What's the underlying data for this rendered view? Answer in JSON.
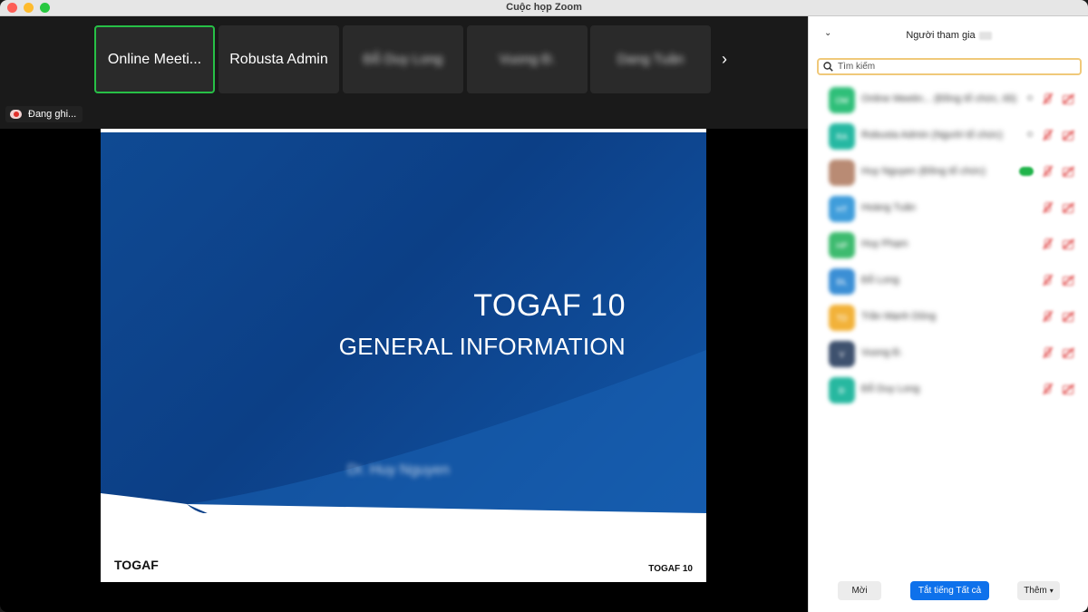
{
  "window": {
    "title": "Cuộc họp Zoom"
  },
  "video_strip": {
    "tiles": [
      {
        "label": "Online Meeti...",
        "active": true
      },
      {
        "label": "Robusta Admin",
        "active": false
      },
      {
        "label": "Đỗ Duy Long",
        "active": false
      },
      {
        "label": "Vuong Đ.",
        "active": false
      },
      {
        "label": "Dang Tuân",
        "active": false
      }
    ],
    "next_icon": "chevron-right-icon",
    "recording_label": "Đang ghi..."
  },
  "slide": {
    "title": "TOGAF 10",
    "subtitle": "GENERAL INFORMATION",
    "author": "Dr. Huy Nguyen",
    "footer_left": "TOGAF",
    "footer_right": "TOGAF 10"
  },
  "participants_panel": {
    "title": "Người tham gia",
    "count": "10",
    "search_placeholder": "Tìm kiếm",
    "participants": [
      {
        "initials": "OM",
        "name": "Online Meetin... (Đồng tổ chức, tôi)",
        "color": "#2fbf79"
      },
      {
        "initials": "RA",
        "name": "Robusta Admin (Người tổ chức)",
        "color": "#25b8a2"
      },
      {
        "initials": "",
        "name": "Huy Nguyen (Đồng tổ chức)",
        "color": "#b98b74"
      },
      {
        "initials": "HT",
        "name": "Hoàng Tuân",
        "color": "#3f9ddb"
      },
      {
        "initials": "HP",
        "name": "Huy Phạm",
        "color": "#3dbb6f"
      },
      {
        "initials": "ĐL",
        "name": "Đỗ Long",
        "color": "#3b8fd5"
      },
      {
        "initials": "TD",
        "name": "Trần Mạnh Dũng",
        "color": "#f2b23a"
      },
      {
        "initials": "V",
        "name": "Vuong Đ.",
        "color": "#3e516e"
      },
      {
        "initials": "Đ",
        "name": "Đỗ Duy Long",
        "color": "#27b8a0"
      }
    ],
    "buttons": {
      "invite": "Mời",
      "mute_all": "Tắt tiếng Tất cả",
      "more": "Thêm"
    },
    "colors": {
      "accent": "#0e71eb",
      "search_focus": "#f0c97a",
      "muted": "#e04848"
    }
  }
}
